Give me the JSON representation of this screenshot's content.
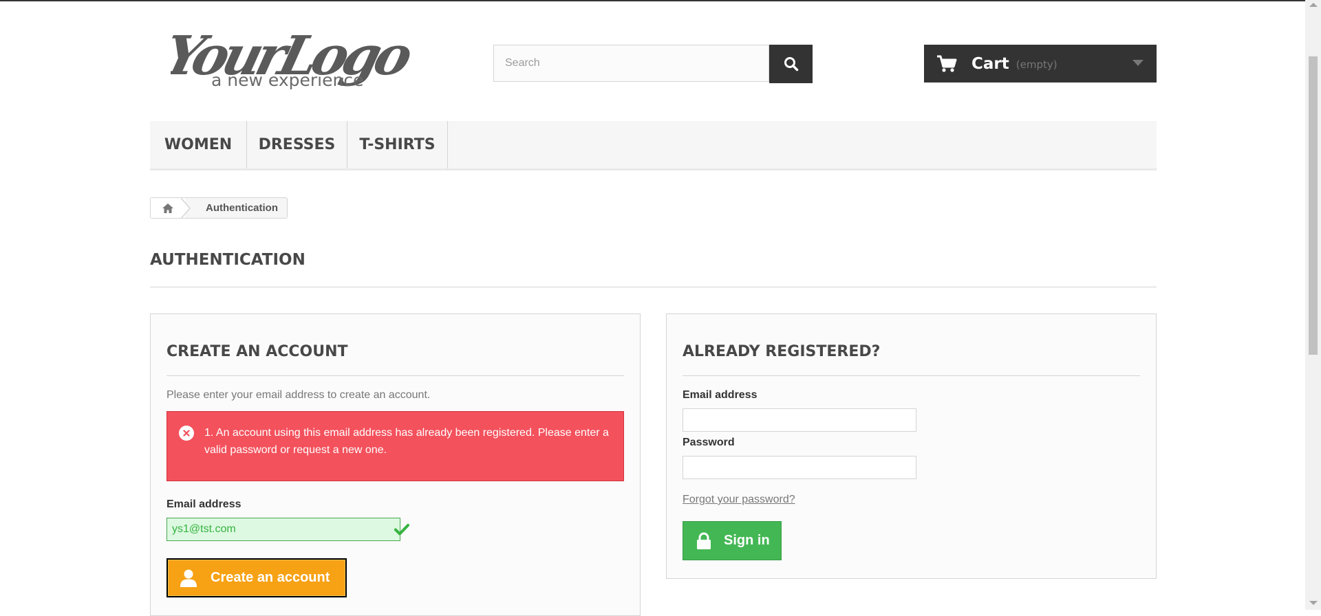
{
  "logo": {
    "main_text": "YourLogo",
    "tagline": "a new experience"
  },
  "search": {
    "placeholder": "Search",
    "icon": "search-icon"
  },
  "cart": {
    "label": "Cart",
    "status": "(empty)",
    "icon": "cart-icon"
  },
  "menu": {
    "items": [
      {
        "label": "WOMEN"
      },
      {
        "label": "DRESSES"
      },
      {
        "label": "T-SHIRTS"
      }
    ]
  },
  "breadcrumb": {
    "home_icon": "home-icon",
    "current": "Authentication"
  },
  "page": {
    "heading": "AUTHENTICATION"
  },
  "create_account": {
    "title": "CREATE AN ACCOUNT",
    "description": "Please enter your email address to create an account.",
    "error": "1. An account using this email address has already been registered. Please enter a valid password or request a new one.",
    "email_label": "Email address",
    "email_value": "ys1@tst.com",
    "button_label": "Create an account"
  },
  "login": {
    "title": "ALREADY REGISTERED?",
    "email_label": "Email address",
    "email_value": "",
    "password_label": "Password",
    "password_value": "",
    "forgot_link": "Forgot your password?",
    "button_label": "Sign in"
  },
  "colors": {
    "dark": "#333333",
    "error_bg": "#f3515c",
    "success_bg": "#ddf9e1",
    "success_text": "#35b33f",
    "create_button": "#f7a114",
    "signin_button": "#43b754"
  }
}
